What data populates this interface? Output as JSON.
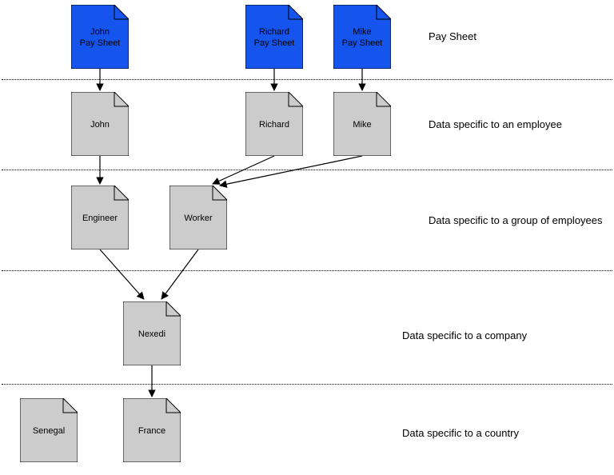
{
  "rows": {
    "r1": "Pay Sheet",
    "r2": "Data specific to an employee",
    "r3": "Data specific to a group of employees",
    "r4": "Data specific to a company",
    "r5": "Data specific to a country"
  },
  "nodes": {
    "john_ps": "John\nPay Sheet",
    "richard_ps": "Richard\nPay Sheet",
    "mike_ps": "Mike\nPay Sheet",
    "john": "John",
    "richard": "Richard",
    "mike": "Mike",
    "engineer": "Engineer",
    "worker": "Worker",
    "nexedi": "Nexedi",
    "senegal": "Senegal",
    "france": "France"
  },
  "colors": {
    "paysheet_fill": "#1555ed",
    "default_fill": "#cccccc"
  }
}
